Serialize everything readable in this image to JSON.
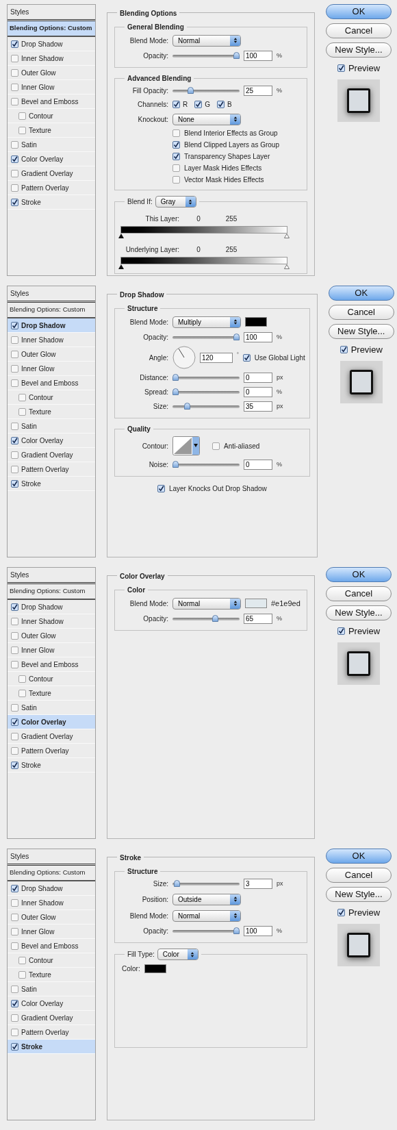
{
  "dialogs": [
    {
      "sidebar": {
        "title": "Styles",
        "items": [
          {
            "kind": "header",
            "label": "Blending Options: Custom",
            "selected": true
          },
          {
            "kind": "effect",
            "label": "Drop Shadow",
            "checked": true,
            "selected": false
          },
          {
            "kind": "effect",
            "label": "Inner Shadow",
            "checked": false,
            "selected": false
          },
          {
            "kind": "effect",
            "label": "Outer Glow",
            "checked": false,
            "selected": false
          },
          {
            "kind": "effect",
            "label": "Inner Glow",
            "checked": false,
            "selected": false
          },
          {
            "kind": "effect",
            "label": "Bevel and Emboss",
            "checked": false,
            "selected": false,
            "children": [
              {
                "kind": "effect",
                "label": "Contour",
                "checked": false,
                "selected": false
              },
              {
                "kind": "effect",
                "label": "Texture",
                "checked": false,
                "selected": false
              }
            ]
          },
          {
            "kind": "effect",
            "label": "Satin",
            "checked": false,
            "selected": false
          },
          {
            "kind": "effect",
            "label": "Color Overlay",
            "checked": true,
            "selected": false
          },
          {
            "kind": "effect",
            "label": "Gradient Overlay",
            "checked": false,
            "selected": false
          },
          {
            "kind": "effect",
            "label": "Pattern Overlay",
            "checked": false,
            "selected": false
          },
          {
            "kind": "effect",
            "label": "Stroke",
            "checked": true,
            "selected": false
          }
        ]
      },
      "panel": {
        "title": "Blending Options",
        "items": [
          {
            "kind": "group",
            "title": "General Blending",
            "rows": [
              {
                "kind": "select",
                "label": "Blend Mode:",
                "value": "Normal"
              },
              {
                "kind": "slider",
                "label": "Opacity:",
                "level": 1,
                "value": "100",
                "unit": "%"
              }
            ]
          },
          {
            "kind": "group",
            "title": "Advanced Blending",
            "rows": [
              {
                "kind": "slider",
                "label": "Fill Opacity:",
                "level": 0.25,
                "value": "25",
                "unit": "%"
              },
              {
                "kind": "channels",
                "label": "Channels:",
                "options": [
                  {
                    "label": "R",
                    "checked": true
                  },
                  {
                    "label": "G",
                    "checked": true
                  },
                  {
                    "label": "B",
                    "checked": true
                  }
                ]
              },
              {
                "kind": "select",
                "label": "Knockout:",
                "value": "None"
              },
              {
                "kind": "checkbox",
                "label": "Blend Interior Effects as Group",
                "checked": false
              },
              {
                "kind": "checkbox",
                "label": "Blend Clipped Layers as Group",
                "checked": true
              },
              {
                "kind": "checkbox",
                "label": "Transparency Shapes Layer",
                "checked": true
              },
              {
                "kind": "checkbox",
                "label": "Layer Mask Hides Effects",
                "checked": false
              },
              {
                "kind": "checkbox",
                "label": "Vector Mask Hides Effects",
                "checked": false
              }
            ]
          },
          {
            "kind": "group",
            "select": {
              "label": "Blend If:",
              "value": "Gray"
            },
            "rows": [
              {
                "kind": "range",
                "label": "This Layer:",
                "low": "0",
                "high": "255"
              },
              {
                "kind": "range",
                "label": "Underlying Layer:",
                "low": "0",
                "high": "255"
              }
            ]
          }
        ]
      },
      "buttons": [
        {
          "label": "OK",
          "primary": true
        },
        {
          "label": "Cancel",
          "primary": false
        },
        {
          "label": "New Style...",
          "primary": false
        }
      ],
      "preview": {
        "label": "Preview",
        "checked": true
      }
    },
    {
      "sidebar": {
        "title": "Styles",
        "items": [
          {
            "kind": "header",
            "label": "Blending Options: Custom",
            "selected": false
          },
          {
            "kind": "effect",
            "label": "Drop Shadow",
            "checked": true,
            "selected": true
          },
          {
            "kind": "effect",
            "label": "Inner Shadow",
            "checked": false,
            "selected": false
          },
          {
            "kind": "effect",
            "label": "Outer Glow",
            "checked": false,
            "selected": false
          },
          {
            "kind": "effect",
            "label": "Inner Glow",
            "checked": false,
            "selected": false
          },
          {
            "kind": "effect",
            "label": "Bevel and Emboss",
            "checked": false,
            "selected": false,
            "children": [
              {
                "kind": "effect",
                "label": "Contour",
                "checked": false,
                "selected": false
              },
              {
                "kind": "effect",
                "label": "Texture",
                "checked": false,
                "selected": false
              }
            ]
          },
          {
            "kind": "effect",
            "label": "Satin",
            "checked": false,
            "selected": false
          },
          {
            "kind": "effect",
            "label": "Color Overlay",
            "checked": true,
            "selected": false
          },
          {
            "kind": "effect",
            "label": "Gradient Overlay",
            "checked": false,
            "selected": false
          },
          {
            "kind": "effect",
            "label": "Pattern Overlay",
            "checked": false,
            "selected": false
          },
          {
            "kind": "effect",
            "label": "Stroke",
            "checked": true,
            "selected": false
          }
        ]
      },
      "panel": {
        "title": "Drop Shadow",
        "items": [
          {
            "kind": "group",
            "title": "Structure",
            "rows": [
              {
                "kind": "select",
                "label": "Blend Mode:",
                "value": "Multiply",
                "color": "#000000"
              },
              {
                "kind": "slider",
                "label": "Opacity:",
                "level": 1,
                "value": "100",
                "unit": "%"
              },
              {
                "kind": "angle",
                "label": "Angle:",
                "value": "120",
                "unit": "°",
                "option": {
                  "label": "Use Global Light",
                  "checked": true
                }
              },
              {
                "kind": "slider",
                "label": "Distance:",
                "level": 0,
                "value": "0",
                "unit": "px"
              },
              {
                "kind": "slider",
                "label": "Spread:",
                "level": 0,
                "value": "0",
                "unit": "%"
              },
              {
                "kind": "slider",
                "label": "Size:",
                "level": 0.19,
                "value": "35",
                "unit": "px"
              }
            ]
          },
          {
            "kind": "group",
            "title": "Quality",
            "rows": [
              {
                "kind": "contour",
                "label": "Contour:",
                "option": {
                  "label": "Anti-aliased",
                  "checked": false
                }
              },
              {
                "kind": "slider",
                "label": "Noise:",
                "level": 0,
                "value": "0",
                "unit": "%"
              }
            ]
          },
          {
            "kind": "checkbox",
            "label": "Layer Knocks Out Drop Shadow",
            "checked": true
          }
        ]
      },
      "buttons": [
        {
          "label": "OK",
          "primary": true
        },
        {
          "label": "Cancel",
          "primary": false
        },
        {
          "label": "New Style...",
          "primary": false
        }
      ],
      "preview": {
        "label": "Preview",
        "checked": true
      }
    },
    {
      "sidebar": {
        "title": "Styles",
        "items": [
          {
            "kind": "header",
            "label": "Blending Options: Custom",
            "selected": false
          },
          {
            "kind": "effect",
            "label": "Drop Shadow",
            "checked": true,
            "selected": false
          },
          {
            "kind": "effect",
            "label": "Inner Shadow",
            "checked": false,
            "selected": false
          },
          {
            "kind": "effect",
            "label": "Outer Glow",
            "checked": false,
            "selected": false
          },
          {
            "kind": "effect",
            "label": "Inner Glow",
            "checked": false,
            "selected": false
          },
          {
            "kind": "effect",
            "label": "Bevel and Emboss",
            "checked": false,
            "selected": false,
            "children": [
              {
                "kind": "effect",
                "label": "Contour",
                "checked": false,
                "selected": false
              },
              {
                "kind": "effect",
                "label": "Texture",
                "checked": false,
                "selected": false
              }
            ]
          },
          {
            "kind": "effect",
            "label": "Satin",
            "checked": false,
            "selected": false
          },
          {
            "kind": "effect",
            "label": "Color Overlay",
            "checked": true,
            "selected": true
          },
          {
            "kind": "effect",
            "label": "Gradient Overlay",
            "checked": false,
            "selected": false
          },
          {
            "kind": "effect",
            "label": "Pattern Overlay",
            "checked": false,
            "selected": false
          },
          {
            "kind": "effect",
            "label": "Stroke",
            "checked": true,
            "selected": false
          }
        ]
      },
      "panel": {
        "title": "Color Overlay",
        "items": [
          {
            "kind": "group",
            "title": "Color",
            "rows": [
              {
                "kind": "select",
                "label": "Blend Mode:",
                "value": "Normal",
                "color": "#e1e9ed",
                "hex": "#e1e9ed"
              },
              {
                "kind": "slider",
                "label": "Opacity:",
                "level": 0.65,
                "value": "65",
                "unit": "%"
              }
            ]
          }
        ]
      },
      "buttons": [
        {
          "label": "OK",
          "primary": true
        },
        {
          "label": "Cancel",
          "primary": false
        },
        {
          "label": "New Style...",
          "primary": false
        }
      ],
      "preview": {
        "label": "Preview",
        "checked": true
      }
    },
    {
      "sidebar": {
        "title": "Styles",
        "items": [
          {
            "kind": "header",
            "label": "Blending Options: Custom",
            "selected": false
          },
          {
            "kind": "effect",
            "label": "Drop Shadow",
            "checked": true,
            "selected": false
          },
          {
            "kind": "effect",
            "label": "Inner Shadow",
            "checked": false,
            "selected": false
          },
          {
            "kind": "effect",
            "label": "Outer Glow",
            "checked": false,
            "selected": false
          },
          {
            "kind": "effect",
            "label": "Inner Glow",
            "checked": false,
            "selected": false
          },
          {
            "kind": "effect",
            "label": "Bevel and Emboss",
            "checked": false,
            "selected": false,
            "children": [
              {
                "kind": "effect",
                "label": "Contour",
                "checked": false,
                "selected": false
              },
              {
                "kind": "effect",
                "label": "Texture",
                "checked": false,
                "selected": false
              }
            ]
          },
          {
            "kind": "effect",
            "label": "Satin",
            "checked": false,
            "selected": false
          },
          {
            "kind": "effect",
            "label": "Color Overlay",
            "checked": true,
            "selected": false
          },
          {
            "kind": "effect",
            "label": "Gradient Overlay",
            "checked": false,
            "selected": false
          },
          {
            "kind": "effect",
            "label": "Pattern Overlay",
            "checked": false,
            "selected": false
          },
          {
            "kind": "effect",
            "label": "Stroke",
            "checked": true,
            "selected": true
          }
        ]
      },
      "panel": {
        "title": "Stroke",
        "items": [
          {
            "kind": "group",
            "title": "Structure",
            "rows": [
              {
                "kind": "slider",
                "label": "Size:",
                "level": 0.02,
                "value": "3",
                "unit": "px"
              },
              {
                "kind": "select",
                "label": "Position:",
                "value": "Outside"
              },
              {
                "kind": "select",
                "label": "Blend Mode:",
                "value": "Normal"
              },
              {
                "kind": "slider",
                "label": "Opacity:",
                "level": 1,
                "value": "100",
                "unit": "%"
              }
            ]
          },
          {
            "kind": "group",
            "select": {
              "label": "Fill Type:",
              "value": "Color"
            },
            "rows": [
              {
                "kind": "color",
                "label": "Color:",
                "color": "#000000"
              }
            ]
          }
        ]
      },
      "buttons": [
        {
          "label": "OK",
          "primary": true
        },
        {
          "label": "Cancel",
          "primary": false
        },
        {
          "label": "New Style...",
          "primary": false
        }
      ],
      "preview": {
        "label": "Preview",
        "checked": true
      }
    }
  ]
}
